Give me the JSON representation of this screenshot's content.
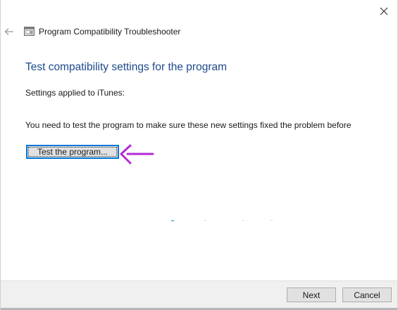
{
  "window": {
    "title": "Program Compatibility Troubleshooter",
    "close_icon": "close-icon",
    "back_icon": "back-arrow-icon",
    "app_icon": "troubleshooter-icon"
  },
  "main": {
    "page_title": "Test compatibility settings for the program",
    "settings_label": "Settings applied to iTunes:",
    "info_text": "You need to test the program to make sure these new settings fixed the problem before",
    "test_button_label": "Test the program..."
  },
  "annotation": {
    "arrow_color": "#b42ad8"
  },
  "footer": {
    "next_label": "Next",
    "cancel_label": "Cancel"
  },
  "colors": {
    "title_blue": "#1e4a8c",
    "focus_blue": "#0078d7"
  }
}
